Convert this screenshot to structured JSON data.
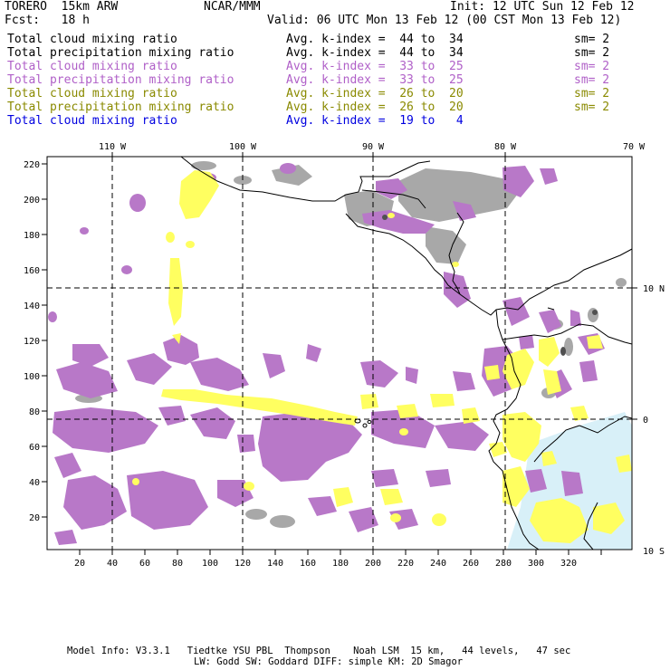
{
  "header": {
    "model": "TORERO  15km ARW",
    "center": "NCAR/MMM",
    "init": "Init: 12 UTC Sun 12 Feb 12",
    "fcst": "Fcst:   18 h",
    "valid": "Valid: 06 UTC Mon 13 Feb 12 (00 CST Mon 13 Feb 12)"
  },
  "legend": [
    {
      "field": "Total cloud mixing ratio",
      "kidx": "Avg. k-index =  44 to  34",
      "sm": "sm= 2",
      "color": "#000000"
    },
    {
      "field": "Total precipitation mixing ratio",
      "kidx": "Avg. k-index =  44 to  34",
      "sm": "sm= 2",
      "color": "#000000"
    },
    {
      "field": "Total cloud mixing ratio",
      "kidx": "Avg. k-index =  33 to  25",
      "sm": "sm= 2",
      "color": "#b060c8"
    },
    {
      "field": "Total precipitation mixing ratio",
      "kidx": "Avg. k-index =  33 to  25",
      "sm": "sm= 2",
      "color": "#b060c8"
    },
    {
      "field": "Total cloud mixing ratio",
      "kidx": "Avg. k-index =  26 to  20",
      "sm": "sm= 2",
      "color": "#8a8a00"
    },
    {
      "field": "Total precipitation mixing ratio",
      "kidx": "Avg. k-index =  26 to  20",
      "sm": "sm= 2",
      "color": "#8a8a00"
    },
    {
      "field": "Total cloud mixing ratio",
      "kidx": "Avg. k-index =  19 to   4",
      "sm": "",
      "color": "#0000e0"
    }
  ],
  "axes": {
    "lon_labels": [
      "110 W",
      "100 W",
      "90 W",
      "80 W",
      "70 W"
    ],
    "lat_labels": [
      "10 N",
      "0",
      "10 S"
    ],
    "x_ticks": [
      "20",
      "40",
      "60",
      "80",
      "100",
      "120",
      "140",
      "160",
      "180",
      "200",
      "220",
      "240",
      "260",
      "280",
      "300",
      "320"
    ],
    "y_ticks": [
      "220",
      "200",
      "180",
      "160",
      "140",
      "120",
      "100",
      "80",
      "60",
      "40",
      "20"
    ]
  },
  "footer": {
    "line1": "Model Info: V3.3.1   Tiedtke YSU PBL  Thompson    Noah LSM  15 km,   44 levels,   47 sec",
    "line2": "LW: Godd SW: Goddard DIFF: simple KM: 2D Smagor"
  },
  "colors": {
    "gray": "#a8a8a8",
    "purple": "#b878c8",
    "yellow": "#ffff60",
    "lightblue": "#d8f0f8"
  }
}
